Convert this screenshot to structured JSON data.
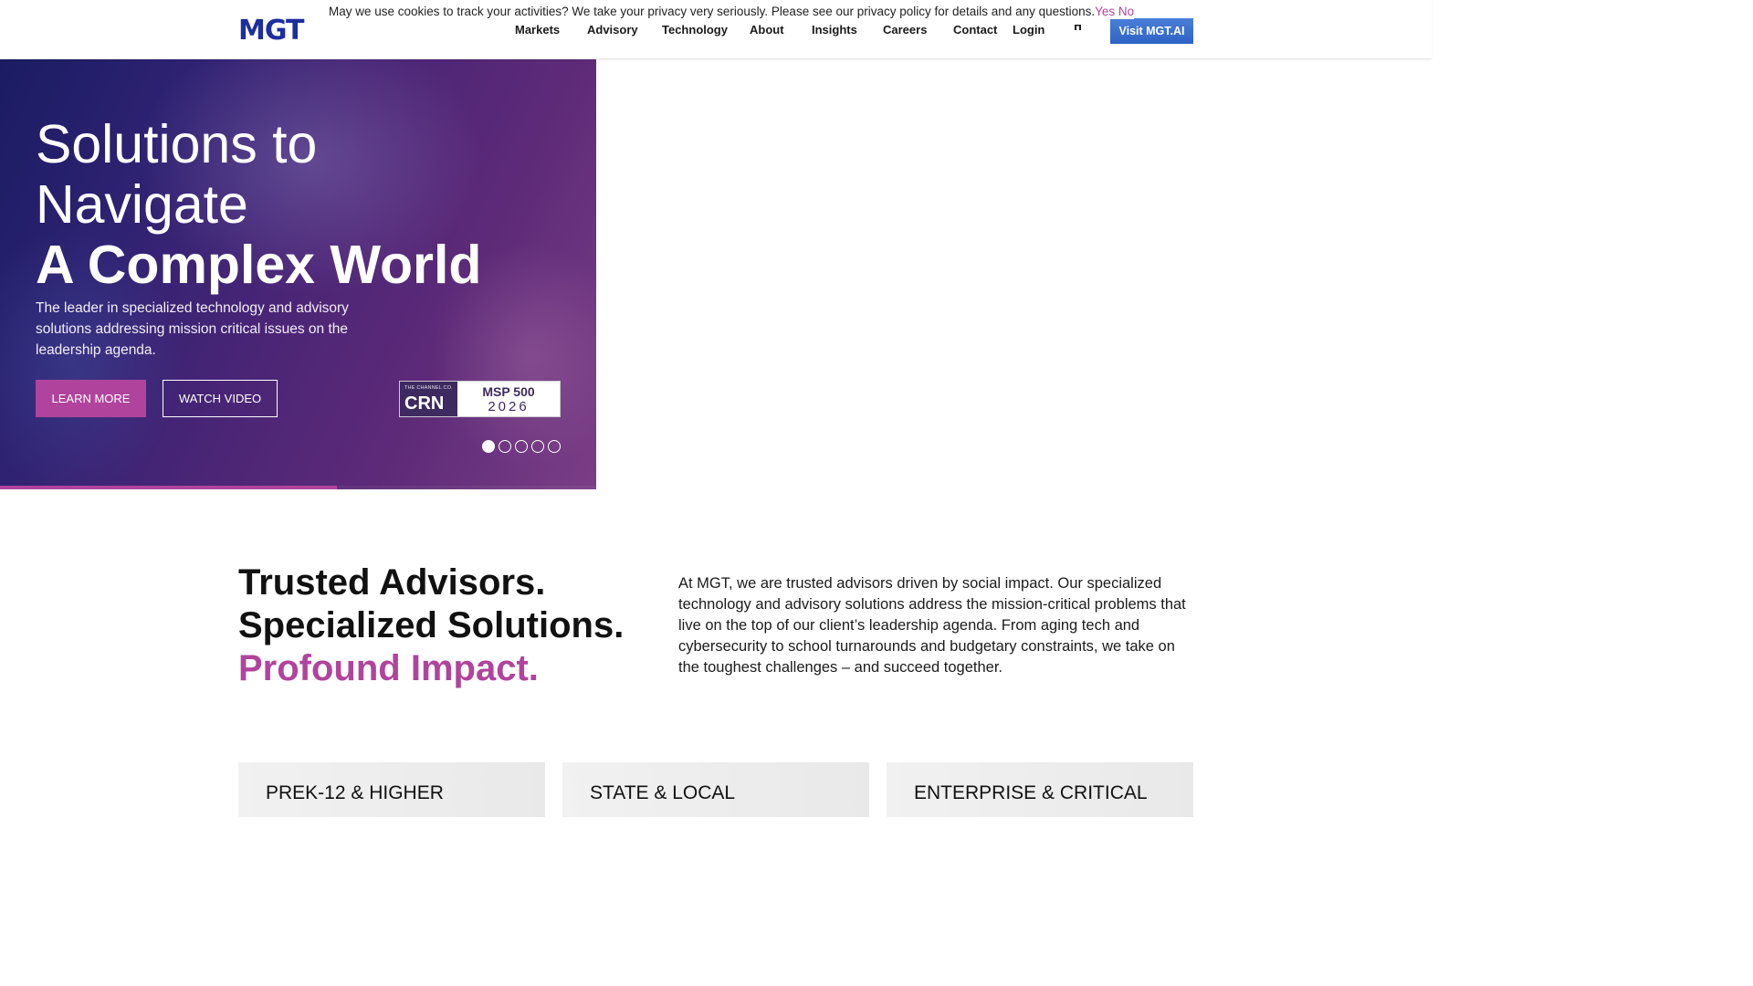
{
  "header": {
    "logo_text": "MGT",
    "cookie_message": "May we use cookies to track your activities? We take your privacy very seriously. Please see our privacy policy for details and any questions.",
    "cookie_yes": "Yes",
    "cookie_no": "No",
    "nav": [
      {
        "label": "Markets"
      },
      {
        "label": "Advisory"
      },
      {
        "label": "Technology"
      },
      {
        "label": "About"
      },
      {
        "label": "Insights"
      },
      {
        "label": "Careers"
      },
      {
        "label": "Contact"
      },
      {
        "label": "Login"
      }
    ],
    "visit_button": "Visit MGT.AI"
  },
  "hero": {
    "title_line1": "Solutions to",
    "title_line2": "Navigate",
    "title_line3": "A Complex World",
    "subtitle": "The leader in specialized technology and advisory solutions addressing mission critical issues on the leadership agenda.",
    "learn_more": "LEARN MORE",
    "watch_video": "WATCH VIDEO",
    "badge": {
      "small": "THE CHANNEL CO.",
      "brand": "CRN",
      "title": "MSP 500",
      "year": "2026"
    },
    "slides_count": 5,
    "active_slide": 1,
    "slide_progress": 0.565,
    "accent_color": "#b0449c"
  },
  "intro": {
    "heading_line1": "Trusted Advisors.",
    "heading_line2": "Specialized Solutions.",
    "heading_line3": "Profound Impact.",
    "body": "At MGT, we are trusted advisors driven by social impact. Our specialized technology and advisory solutions address the mission-critical problems that live on the top of our client’s leadership agenda. From aging tech and cybersecurity to school turnarounds and budgetary constraints, we take on the toughest challenges – and succeed together."
  },
  "cards": [
    {
      "title": "PREK-12 & HIGHER"
    },
    {
      "title": "STATE & LOCAL"
    },
    {
      "title": "ENTERPRISE & CRITICAL"
    }
  ]
}
